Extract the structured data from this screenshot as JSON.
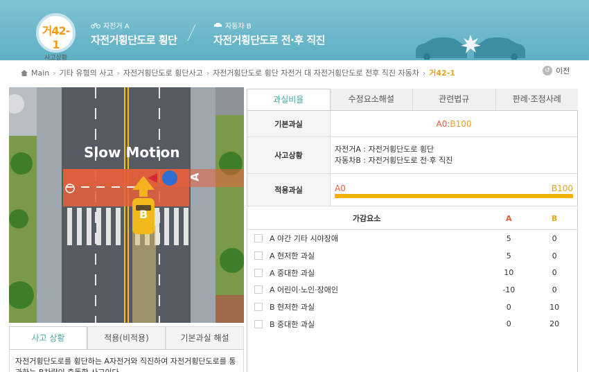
{
  "header": {
    "badge_code": "거42-1",
    "badge_sub": "사고상황",
    "party_a_tag": "자전거 A",
    "party_a_title": "자전거횡단도로 횡단",
    "party_b_tag": "자동차 B",
    "party_b_title": "자전거횡단도로 전·후 직진"
  },
  "breadcrumb": {
    "items": [
      "Main",
      "기타 유형의 사고",
      "자전거횡단도로 횡단사고",
      "자전거횡단도로 횡단 자전거 대 자전거횡단도로 전후 직진 자동차"
    ],
    "current": "거42-1",
    "prev_label": "이전"
  },
  "video": {
    "overlay_text": "Slow Motion",
    "label_a": "A",
    "label_b": "B"
  },
  "left_tabs": [
    "사고 상황",
    "적용(비적용)",
    "기본과실 해설"
  ],
  "left_text": "자전거횡단도로를 횡단하는 A자전거와 직진하여 자전거횡단도로를 통과하는 B차량이 충돌한 사고이다.",
  "right_tabs": [
    "과실비율",
    "수정요소해설",
    "관련법규",
    "판례·조정사례"
  ],
  "info": {
    "basic_label": "기본과실",
    "basic_a": "A0",
    "basic_sep": " : ",
    "basic_b": "B100",
    "situation_label": "사고상황",
    "situation_line1": "자전거A : 자전거횡단도로 횡단",
    "situation_line2": "자동차B : 자전거횡단도로 전·후 직진",
    "applied_label": "적용과실",
    "applied_a": "A0",
    "applied_b": "B100",
    "applied_b_share": 1.0
  },
  "factors": {
    "header": {
      "name": "가감요소",
      "a": "A",
      "b": "B"
    },
    "rows": [
      {
        "name": "A 야간 기타 시야장애",
        "a": "5",
        "b": "0"
      },
      {
        "name": "A 현저한 과실",
        "a": "5",
        "b": "0"
      },
      {
        "name": "A 중대한 과실",
        "a": "10",
        "b": "0"
      },
      {
        "name": "A 어린이·노인·장애인",
        "a": "-10",
        "b": "0"
      },
      {
        "name": "B 현저한 과실",
        "a": "0",
        "b": "10"
      },
      {
        "name": "B 중대한 과실",
        "a": "0",
        "b": "20"
      }
    ]
  },
  "colors": {
    "header_bg": "#6bb8cb",
    "accent_orange": "#e9a21b",
    "accent_red": "#ea5a3a",
    "tab_active": "#4aa9a2"
  }
}
